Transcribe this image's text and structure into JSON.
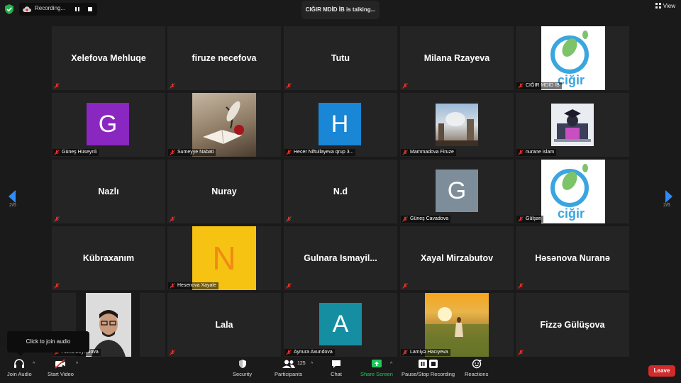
{
  "topbar": {
    "recording_label": "Recording...",
    "talking_label": "CIĞIR MDİD İB is talking...",
    "view_label": "View"
  },
  "pagination": {
    "left": "2/6",
    "right": "2/6"
  },
  "tiles": [
    {
      "name": "Xelefova Mehluqe",
      "label": ""
    },
    {
      "name": "firuze necefova",
      "label": ""
    },
    {
      "name": "Tutu",
      "label": ""
    },
    {
      "name": "Milana Rzayeva",
      "label": ""
    },
    {
      "name": "",
      "label": "CIĞIR MDİD İB",
      "logo_text": "ciğir"
    },
    {
      "name": "",
      "label": "Güneş Hüseynli",
      "avatar_letter": "G",
      "avatar_color": "#8a27c0"
    },
    {
      "name": "",
      "label": "Sumeyye Nabati",
      "image": "book-rose-photo"
    },
    {
      "name": "",
      "label": "Hecer Niftullayeva qrup 3...",
      "avatar_letter": "H",
      "avatar_color": "#1a86d6"
    },
    {
      "name": "",
      "label": "Mammadova Firuze",
      "image": "city-photo"
    },
    {
      "name": "",
      "label": "nurane islam",
      "image": "graduate-illustration"
    },
    {
      "name": "Nazlı",
      "label": ""
    },
    {
      "name": "Nuray",
      "label": ""
    },
    {
      "name": "N.d",
      "label": ""
    },
    {
      "name": "",
      "label": "Güneş Cavadova",
      "avatar_letter": "G",
      "avatar_color": "#7d8e9a"
    },
    {
      "name": "",
      "label": "Gülşən",
      "logo_text": "ciğir"
    },
    {
      "name": "Kübraxanım",
      "label": ""
    },
    {
      "name": "",
      "label": "Hesenova Xayale",
      "avatar_letter": "N",
      "avatar_color": "#f7c313",
      "avatar_text_color": "#f08a14"
    },
    {
      "name": "Gulnara  Ismayil...",
      "label": ""
    },
    {
      "name": "Xayal Mirzabutov",
      "label": ""
    },
    {
      "name": "Həsənova Nuranə",
      "label": ""
    },
    {
      "name": "",
      "label": "Aisha Zeynalova",
      "image": "person-photo"
    },
    {
      "name": "Lala",
      "label": ""
    },
    {
      "name": "",
      "label": "Aynura Axundova",
      "avatar_letter": "A",
      "avatar_color": "#168ea2"
    },
    {
      "name": "",
      "label": "Lamiyə Hacıyeva",
      "image": "sunset-photo"
    },
    {
      "name": "Fizzə Gülüşova",
      "label": ""
    }
  ],
  "tooltip": "Click to join audio",
  "toolbar": {
    "join_audio": "Join Audio",
    "start_video": "Start Video",
    "security": "Security",
    "participants": "Participants",
    "participants_count": "125",
    "chat": "Chat",
    "share_screen": "Share Screen",
    "pause_recording": "Pause/Stop Recording",
    "reactions": "Reactions",
    "leave": "Leave"
  },
  "colors": {
    "share_green": "#22c55e",
    "leave_red": "#d12b2b",
    "mic_muted_red": "#e0352b"
  }
}
